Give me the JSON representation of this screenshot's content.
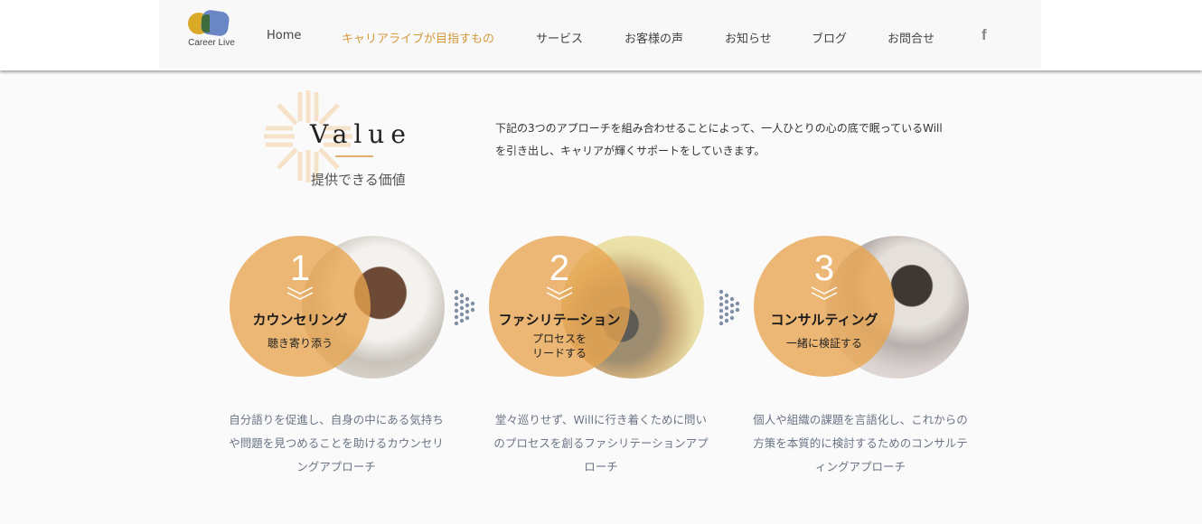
{
  "header": {
    "logo_text": "Career Live",
    "nav": [
      {
        "label": "Home",
        "active": false
      },
      {
        "label": "キャリアライブが目指すもの",
        "active": true
      },
      {
        "label": "サービス",
        "active": false
      },
      {
        "label": "お客様の声",
        "active": false
      },
      {
        "label": "お知らせ",
        "active": false
      },
      {
        "label": "ブログ",
        "active": false
      },
      {
        "label": "お問合せ",
        "active": false
      }
    ],
    "social_icon": "facebook-icon",
    "social_glyph": "f"
  },
  "value": {
    "title": "Value",
    "subtitle": "提供できる価値",
    "intro": "下記の3つのアプローチを組み合わせることによって、一人ひとりの心の底で眠っているWillを引き出し、キャリアが輝くサポートをしていきます。"
  },
  "services": [
    {
      "number": "1",
      "title": "カウンセリング",
      "subtitle": "聴き寄り添う",
      "description": "自分語りを促進し、自身の中にある気持ちや問題を見つめることを助けるカウンセリングアプローチ"
    },
    {
      "number": "2",
      "title": "ファシリテーション",
      "subtitle": "プロセスを\nリードする",
      "description": "堂々巡りせず、Willに行き着くために問いのプロセスを創るファシリテーションアプローチ"
    },
    {
      "number": "3",
      "title": "コンサルティング",
      "subtitle": "一緒に検証する",
      "description": "個人や組織の課題を言語化し、これからの方策を本質的に検討するためのコンサルティングアプローチ"
    }
  ],
  "colors": {
    "accent": "#e8a44e",
    "nav_active": "#d49a3c",
    "description_text": "#6a7485",
    "arrow_dots": "#7f90a6"
  }
}
